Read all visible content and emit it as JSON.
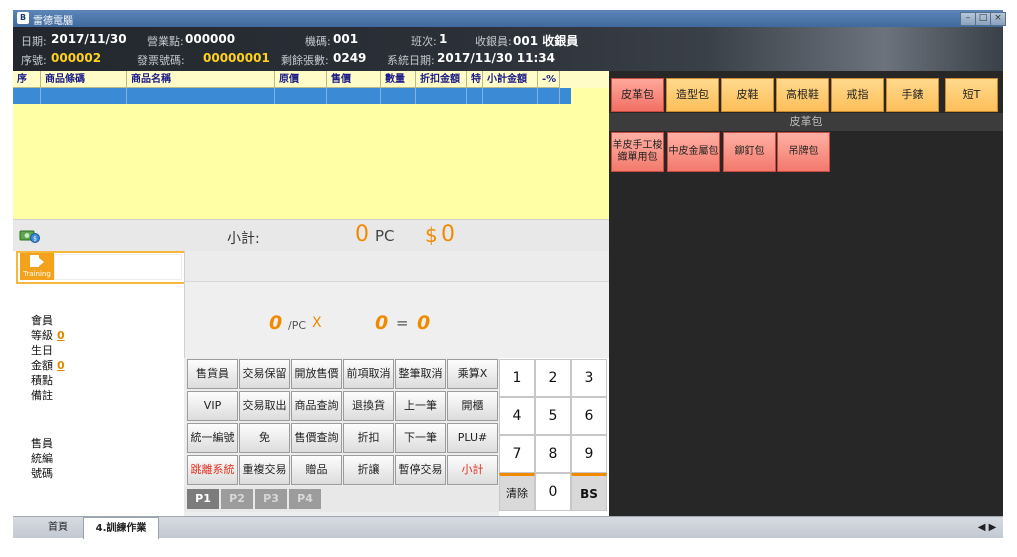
{
  "window": {
    "title": "雷德電腦"
  },
  "header": {
    "date_label": "日期:",
    "date_value": "2017/11/30",
    "store_label": "營業點:",
    "store_value": "000000",
    "machine_label": "機碼:",
    "machine_value": "001",
    "shift_label": "班次:",
    "shift_value": "1",
    "cashier_label": "收銀員:",
    "cashier_value": "001 收銀員",
    "seq_label": "序號:",
    "seq_value": "000002",
    "invoice_label": "發票號碼:",
    "invoice_value": "00000001",
    "remain_label": "剩餘張數:",
    "remain_value": "0249",
    "sysdate_label": "系統日期:",
    "sysdate_value": "2017/11/30   11:34"
  },
  "grid": {
    "columns": [
      "序",
      "商品條碼",
      "商品名稱",
      "原價",
      "售價",
      "數量",
      "折扣金額",
      "特",
      "小計金額",
      "-%"
    ]
  },
  "totals": {
    "subtotal_label": "小計:",
    "qty_value": "0",
    "qty_unit": "PC",
    "currency": "$",
    "amount_value": "0"
  },
  "training": {
    "label": "Training"
  },
  "member": {
    "member_label": "會員",
    "level_label": "等級",
    "level_value": "0",
    "birthday_label": "生日",
    "amount_label": "金額",
    "amount_value": "0",
    "points_label": "積點",
    "note_label": "備註",
    "clerk_label": "售員",
    "taxid_label": "統編",
    "code_label": "號碼"
  },
  "calc": {
    "price": "0",
    "unit": "/PC",
    "times": "X",
    "qty": "0",
    "equals": "=",
    "result": "0"
  },
  "function_keys": [
    [
      "售貨員",
      "交易保留",
      "開放售價",
      "前項取消",
      "整筆取消",
      "乘算X"
    ],
    [
      "VIP",
      "交易取出",
      "商品查詢",
      "退換貨",
      "上一筆",
      "開櫃"
    ],
    [
      "統一編號",
      "免",
      "售價查詢",
      "折扣",
      "下一筆",
      "PLU#"
    ],
    [
      "跳離系統",
      "重複交易",
      "贈品",
      "折讓",
      "暫停交易",
      "小計"
    ]
  ],
  "pages": [
    "P1",
    "P2",
    "P3",
    "P4"
  ],
  "numpad": {
    "keys": [
      [
        "1",
        "2",
        "3"
      ],
      [
        "4",
        "5",
        "6"
      ],
      [
        "7",
        "8",
        "9"
      ],
      [
        "清除",
        "0",
        "BS"
      ]
    ]
  },
  "categories": [
    "皮革包",
    "造型包",
    "皮鞋",
    "高根鞋",
    "戒指",
    "手錶",
    "短T"
  ],
  "category_title": "皮革包",
  "products": [
    "羊皮手工梭織單用包",
    "中皮金屬包",
    "鉚釘包",
    "吊牌包"
  ],
  "tabs": [
    "首頁",
    "4.訓練作業"
  ],
  "tab_scroll": "◀ ▶",
  "colors": {
    "accent_orange": "#f08a00",
    "selected_row": "#3a8ad6",
    "grid_bg": "#ffffa6",
    "category_active": "#f26f63",
    "category_normal": "#fdbf59"
  }
}
